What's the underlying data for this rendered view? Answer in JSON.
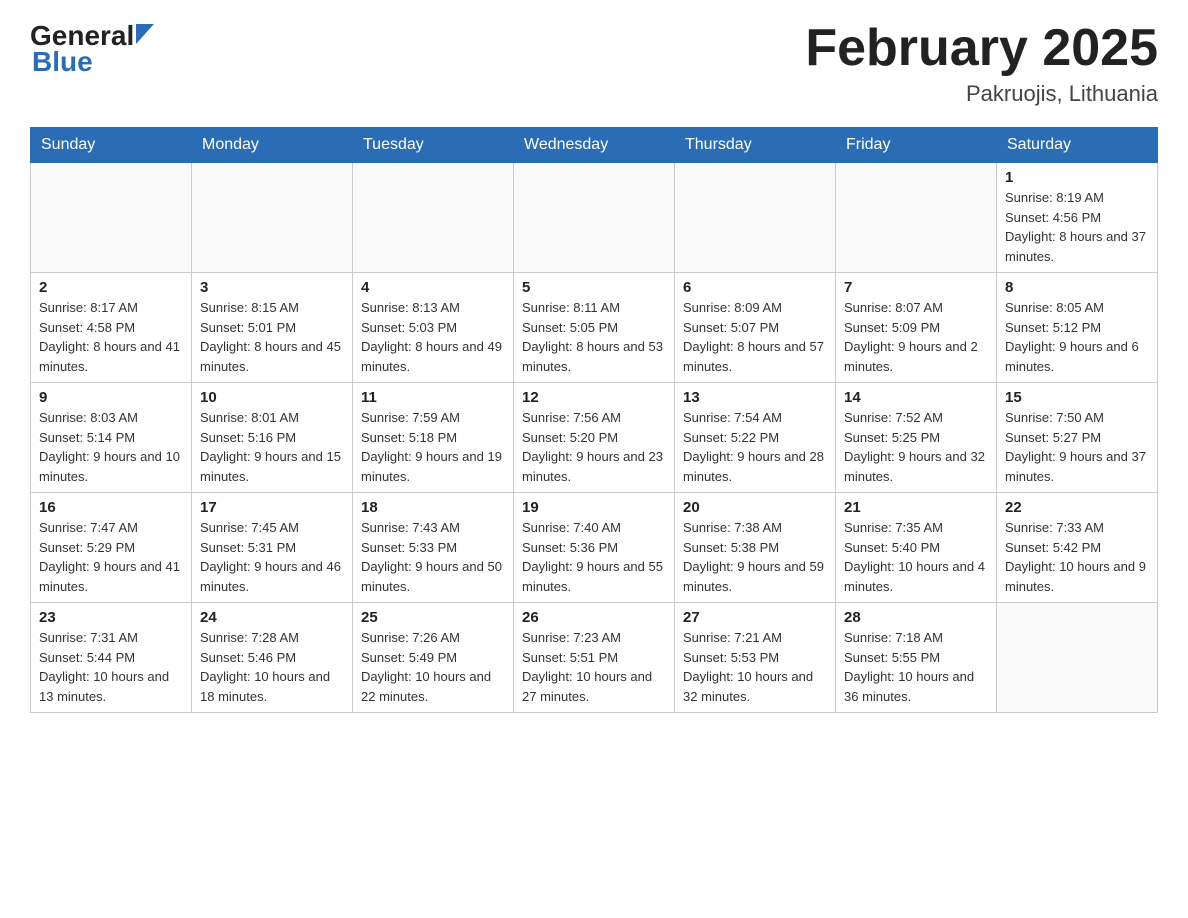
{
  "header": {
    "logo_general": "General",
    "logo_blue": "Blue",
    "title": "February 2025",
    "subtitle": "Pakruojis, Lithuania"
  },
  "weekdays": [
    "Sunday",
    "Monday",
    "Tuesday",
    "Wednesday",
    "Thursday",
    "Friday",
    "Saturday"
  ],
  "weeks": [
    [
      {
        "day": "",
        "info": ""
      },
      {
        "day": "",
        "info": ""
      },
      {
        "day": "",
        "info": ""
      },
      {
        "day": "",
        "info": ""
      },
      {
        "day": "",
        "info": ""
      },
      {
        "day": "",
        "info": ""
      },
      {
        "day": "1",
        "info": "Sunrise: 8:19 AM\nSunset: 4:56 PM\nDaylight: 8 hours and 37 minutes."
      }
    ],
    [
      {
        "day": "2",
        "info": "Sunrise: 8:17 AM\nSunset: 4:58 PM\nDaylight: 8 hours and 41 minutes."
      },
      {
        "day": "3",
        "info": "Sunrise: 8:15 AM\nSunset: 5:01 PM\nDaylight: 8 hours and 45 minutes."
      },
      {
        "day": "4",
        "info": "Sunrise: 8:13 AM\nSunset: 5:03 PM\nDaylight: 8 hours and 49 minutes."
      },
      {
        "day": "5",
        "info": "Sunrise: 8:11 AM\nSunset: 5:05 PM\nDaylight: 8 hours and 53 minutes."
      },
      {
        "day": "6",
        "info": "Sunrise: 8:09 AM\nSunset: 5:07 PM\nDaylight: 8 hours and 57 minutes."
      },
      {
        "day": "7",
        "info": "Sunrise: 8:07 AM\nSunset: 5:09 PM\nDaylight: 9 hours and 2 minutes."
      },
      {
        "day": "8",
        "info": "Sunrise: 8:05 AM\nSunset: 5:12 PM\nDaylight: 9 hours and 6 minutes."
      }
    ],
    [
      {
        "day": "9",
        "info": "Sunrise: 8:03 AM\nSunset: 5:14 PM\nDaylight: 9 hours and 10 minutes."
      },
      {
        "day": "10",
        "info": "Sunrise: 8:01 AM\nSunset: 5:16 PM\nDaylight: 9 hours and 15 minutes."
      },
      {
        "day": "11",
        "info": "Sunrise: 7:59 AM\nSunset: 5:18 PM\nDaylight: 9 hours and 19 minutes."
      },
      {
        "day": "12",
        "info": "Sunrise: 7:56 AM\nSunset: 5:20 PM\nDaylight: 9 hours and 23 minutes."
      },
      {
        "day": "13",
        "info": "Sunrise: 7:54 AM\nSunset: 5:22 PM\nDaylight: 9 hours and 28 minutes."
      },
      {
        "day": "14",
        "info": "Sunrise: 7:52 AM\nSunset: 5:25 PM\nDaylight: 9 hours and 32 minutes."
      },
      {
        "day": "15",
        "info": "Sunrise: 7:50 AM\nSunset: 5:27 PM\nDaylight: 9 hours and 37 minutes."
      }
    ],
    [
      {
        "day": "16",
        "info": "Sunrise: 7:47 AM\nSunset: 5:29 PM\nDaylight: 9 hours and 41 minutes."
      },
      {
        "day": "17",
        "info": "Sunrise: 7:45 AM\nSunset: 5:31 PM\nDaylight: 9 hours and 46 minutes."
      },
      {
        "day": "18",
        "info": "Sunrise: 7:43 AM\nSunset: 5:33 PM\nDaylight: 9 hours and 50 minutes."
      },
      {
        "day": "19",
        "info": "Sunrise: 7:40 AM\nSunset: 5:36 PM\nDaylight: 9 hours and 55 minutes."
      },
      {
        "day": "20",
        "info": "Sunrise: 7:38 AM\nSunset: 5:38 PM\nDaylight: 9 hours and 59 minutes."
      },
      {
        "day": "21",
        "info": "Sunrise: 7:35 AM\nSunset: 5:40 PM\nDaylight: 10 hours and 4 minutes."
      },
      {
        "day": "22",
        "info": "Sunrise: 7:33 AM\nSunset: 5:42 PM\nDaylight: 10 hours and 9 minutes."
      }
    ],
    [
      {
        "day": "23",
        "info": "Sunrise: 7:31 AM\nSunset: 5:44 PM\nDaylight: 10 hours and 13 minutes."
      },
      {
        "day": "24",
        "info": "Sunrise: 7:28 AM\nSunset: 5:46 PM\nDaylight: 10 hours and 18 minutes."
      },
      {
        "day": "25",
        "info": "Sunrise: 7:26 AM\nSunset: 5:49 PM\nDaylight: 10 hours and 22 minutes."
      },
      {
        "day": "26",
        "info": "Sunrise: 7:23 AM\nSunset: 5:51 PM\nDaylight: 10 hours and 27 minutes."
      },
      {
        "day": "27",
        "info": "Sunrise: 7:21 AM\nSunset: 5:53 PM\nDaylight: 10 hours and 32 minutes."
      },
      {
        "day": "28",
        "info": "Sunrise: 7:18 AM\nSunset: 5:55 PM\nDaylight: 10 hours and 36 minutes."
      },
      {
        "day": "",
        "info": ""
      }
    ]
  ]
}
